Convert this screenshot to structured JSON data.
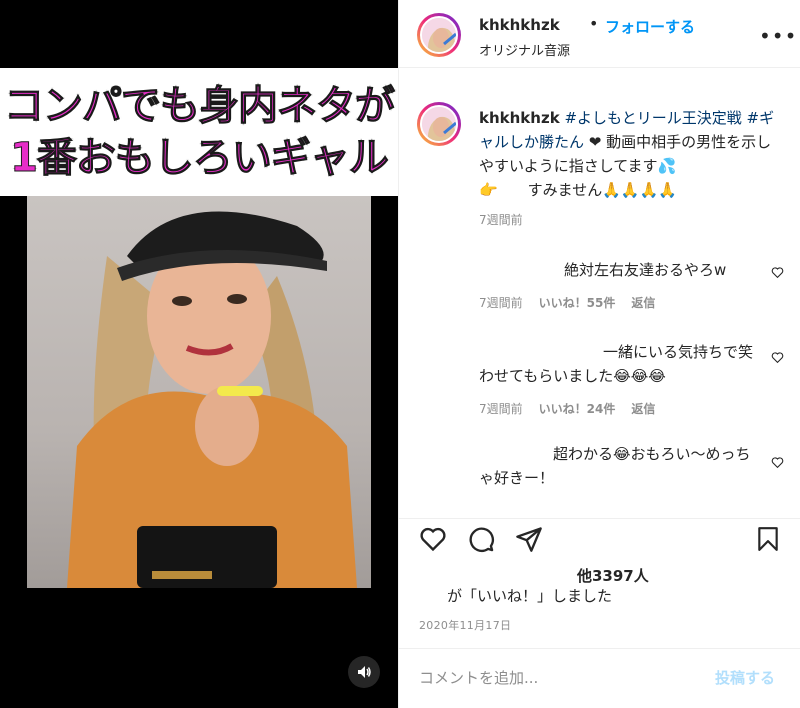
{
  "video": {
    "caption_line1": "コンパでも身内ネタが",
    "caption_line2": "1番おもしろいギャル",
    "sound_icon": "speaker-icon"
  },
  "header": {
    "username": "khkhkhzk",
    "dot": "•",
    "follow_label": "フォローする",
    "audio_label": "オリジナル音源",
    "more_icon": "more-icon",
    "more_text": "•••"
  },
  "caption": {
    "username": "khkhkhzk",
    "tag1": "#よしもとリール王決定戦",
    "tag2": "#ギャルしか勝たん",
    "text_rest": " ❤ 動画中相手の男性を示しやすいように指さしてます💦",
    "line3": "👉　　すみません🙏🙏🙏🙏",
    "time": "7週間前"
  },
  "comments": [
    {
      "text": "絶対左右友達おるやろw",
      "time": "7週間前",
      "likes": "いいね！55件",
      "reply": "返信"
    },
    {
      "text": "一緒にいる気持ちで笑わせてもらいました😂😂😂",
      "time": "7週間前",
      "likes": "いいね！24件",
      "reply": "返信"
    },
    {
      "text": "超わかる😂おもろい〜めっちゃ好きー！"
    }
  ],
  "actions": {
    "likes_count": "他3397人",
    "liked_suffix": "が「いいね！」しました",
    "date": "2020年11月17日"
  },
  "comment_box": {
    "placeholder": "コメントを追加...",
    "post_label": "投稿する"
  },
  "colors": {
    "accent": "#0095f6",
    "caption_pink": "#e62dc8",
    "muted": "#8e8e8e"
  }
}
